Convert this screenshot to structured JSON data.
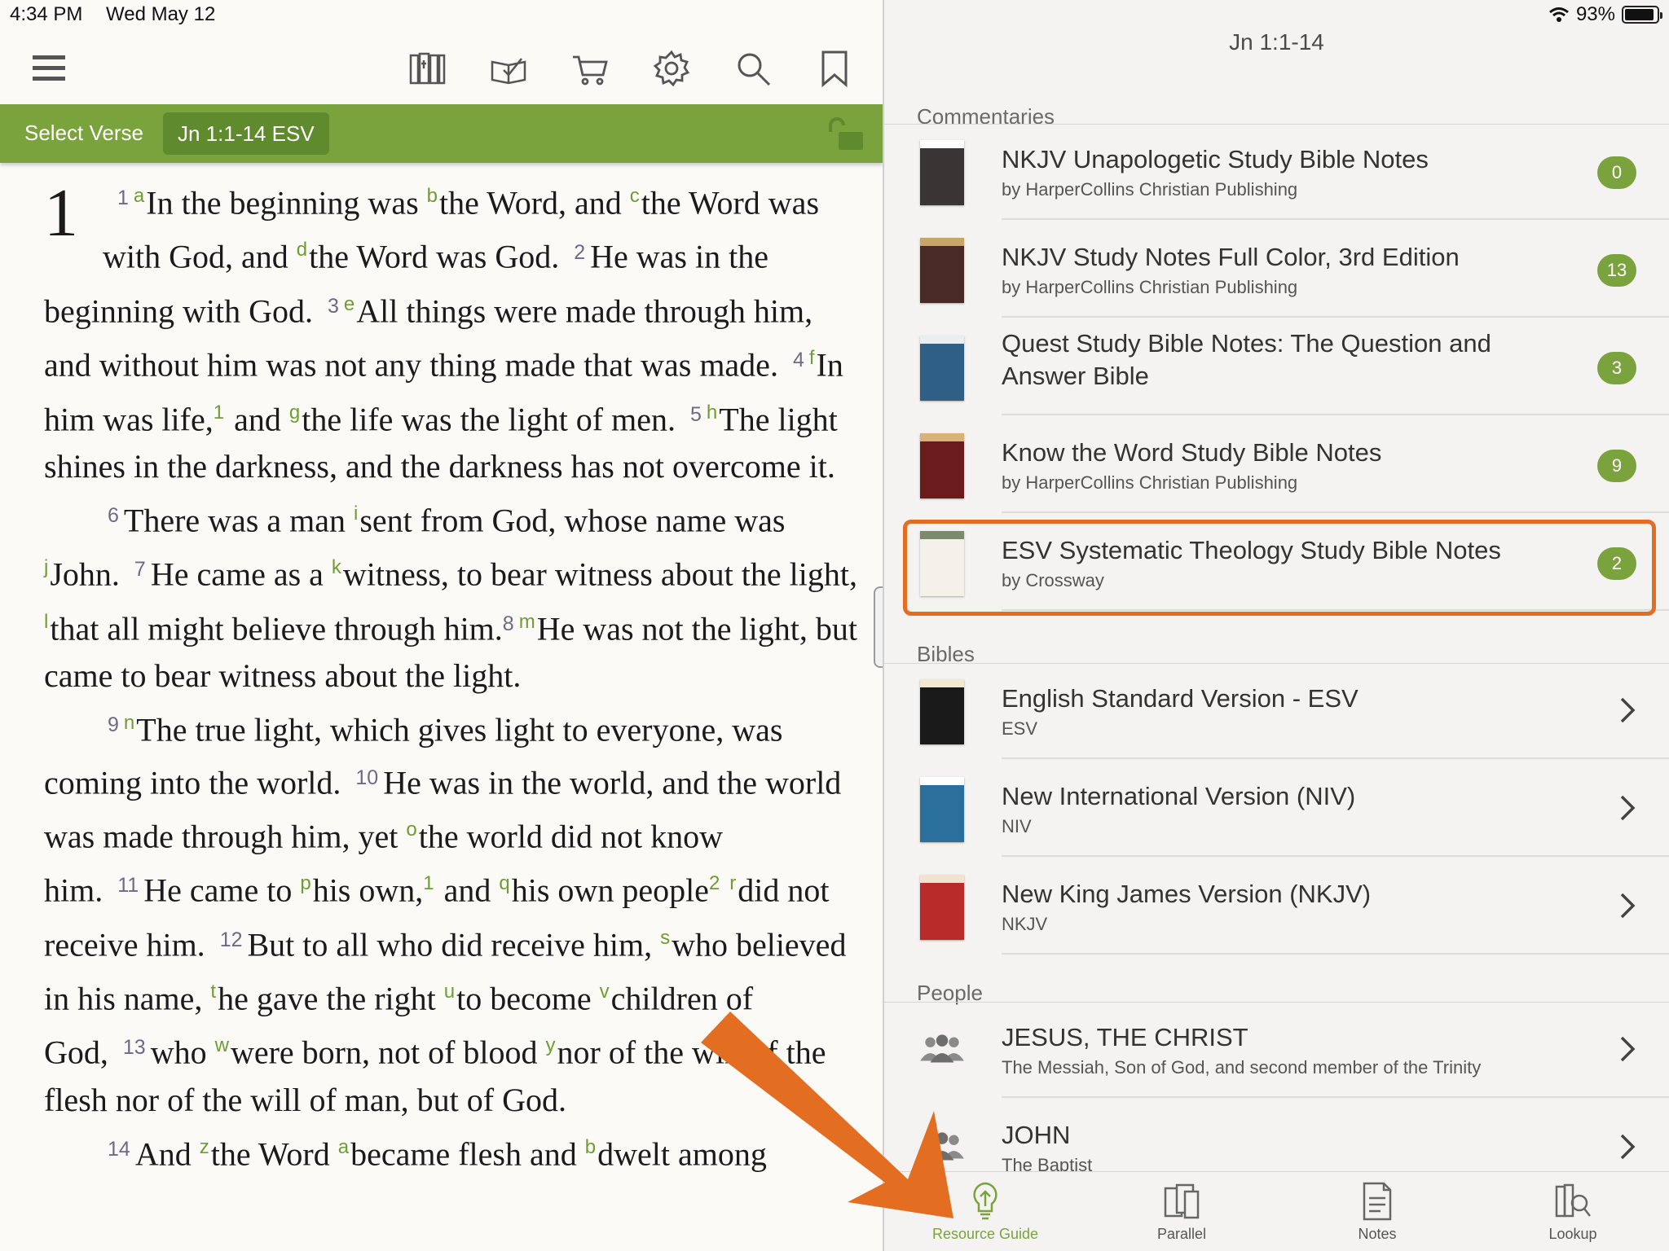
{
  "status": {
    "time": "4:34 PM",
    "date": "Wed May 12",
    "battery": "93%"
  },
  "toolbar": {
    "icons": [
      "menu-icon",
      "library-icon",
      "reading-plan-icon",
      "cart-icon",
      "settings-gear-icon",
      "search-icon",
      "bookmark-icon"
    ]
  },
  "passage_bar": {
    "select_label": "Select Verse",
    "reference": "Jn 1:1-14 ESV"
  },
  "scripture": {
    "chapter": "1",
    "verses": [
      {
        "n": "1",
        "parts": [
          [
            "a",
            "In the beginning was "
          ],
          [
            "b",
            "the Word, and "
          ],
          [
            "c",
            "the Word was with God, and "
          ],
          [
            "d",
            "the Word was God."
          ]
        ]
      },
      {
        "n": "2",
        "parts": [
          [
            "",
            "He was in the beginning with God."
          ]
        ]
      },
      {
        "n": "3",
        "parts": [
          [
            "e",
            "All things were made through him, and without him was not any thing made that was made."
          ]
        ]
      },
      {
        "n": "4",
        "parts": [
          [
            "f",
            "In him was life,"
          ],
          [
            "1",
            " and "
          ],
          [
            "g",
            "the life was the light of men."
          ]
        ]
      },
      {
        "n": "5",
        "parts": [
          [
            "h",
            "The light shines in the darkness, and the darkness has not overcome it."
          ]
        ]
      },
      {
        "n": "6",
        "parts": [
          [
            "",
            "There was a man "
          ],
          [
            "i",
            "sent from God, whose name was "
          ],
          [
            "j",
            "John."
          ]
        ]
      },
      {
        "n": "7",
        "parts": [
          [
            "",
            "He came as a "
          ],
          [
            "k",
            "witness, to bear witness about the light, "
          ],
          [
            "l",
            "that all might believe through him."
          ]
        ]
      },
      {
        "n": "8",
        "parts": [
          [
            "m",
            "He was not the light, but came to bear witness about the light."
          ]
        ]
      },
      {
        "n": "9",
        "parts": [
          [
            "n",
            "The true light, which gives light to everyone, was coming into the world."
          ]
        ]
      },
      {
        "n": "10",
        "parts": [
          [
            "",
            "He was in the world, and the world was made through him, yet "
          ],
          [
            "o",
            "the world did not know him."
          ]
        ]
      },
      {
        "n": "11",
        "parts": [
          [
            "",
            "He came to "
          ],
          [
            "p",
            "his own,"
          ],
          [
            "1",
            " and "
          ],
          [
            "q",
            "his own people"
          ],
          [
            "2",
            " "
          ],
          [
            "r",
            "did not receive him."
          ]
        ]
      },
      {
        "n": "12",
        "parts": [
          [
            "",
            "But to all who did receive him, "
          ],
          [
            "s",
            "who believed in his name, "
          ],
          [
            "t",
            "he gave the right "
          ],
          [
            "u",
            "to become "
          ],
          [
            "v",
            "children of God,"
          ]
        ]
      },
      {
        "n": "13",
        "parts": [
          [
            "",
            "who "
          ],
          [
            "w",
            "were born, not of blood "
          ],
          [
            "y",
            "nor of the will of the flesh nor of the will of man, but of God."
          ]
        ]
      },
      {
        "n": "14",
        "parts": [
          [
            "",
            "And "
          ],
          [
            "z",
            "the Word "
          ],
          [
            "a",
            "became flesh and "
          ],
          [
            "b",
            "dwelt among"
          ]
        ]
      }
    ]
  },
  "resource_guide": {
    "title": "Jn 1:1-14",
    "sections": [
      {
        "heading": "Commentaries",
        "items": [
          {
            "title": "NKJV Unapologetic Study Bible Notes",
            "subtitle": "by HarperCollins Christian Publishing",
            "count": "0",
            "cover": "unapologetic"
          },
          {
            "title": "NKJV Study Notes Full Color, 3rd Edition",
            "subtitle": "by HarperCollins Christian Publishing",
            "count": "13",
            "cover": "nkjv-study"
          },
          {
            "title": "Quest Study Bible Notes: The Question and Answer Bible",
            "subtitle": "",
            "count": "3",
            "cover": "quest"
          },
          {
            "title": "Know the Word Study Bible Notes",
            "subtitle": "by HarperCollins Christian Publishing",
            "count": "9",
            "cover": "know-word"
          },
          {
            "title": "ESV Systematic Theology Study Bible Notes",
            "subtitle": "by Crossway",
            "count": "2",
            "cover": "esv-systematic",
            "highlighted": true
          }
        ]
      },
      {
        "heading": "Bibles",
        "items": [
          {
            "title": "English Standard Version - ESV",
            "subtitle": "ESV",
            "cover": "esv"
          },
          {
            "title": "New International Version (NIV)",
            "subtitle": "NIV",
            "cover": "niv"
          },
          {
            "title": "New King James Version (NKJV)",
            "subtitle": "NKJV",
            "cover": "nkjv"
          }
        ]
      },
      {
        "heading": "People",
        "items": [
          {
            "title": "JESUS, THE CHRIST",
            "subtitle": "The Messiah, Son of God, and second member of the Trinity",
            "cover": "people-icon"
          },
          {
            "title": "JOHN",
            "subtitle": "The Baptist",
            "cover": "people-icon"
          }
        ]
      }
    ]
  },
  "tabs": [
    {
      "label": "Resource Guide",
      "icon": "lightbulb-icon",
      "active": true
    },
    {
      "label": "Parallel",
      "icon": "parallel-books-icon",
      "active": false
    },
    {
      "label": "Notes",
      "icon": "notes-icon",
      "active": false
    },
    {
      "label": "Lookup",
      "icon": "lookup-icon",
      "active": false
    }
  ],
  "colors": {
    "accent_green": "#7aa33e",
    "highlight_orange": "#e36d21",
    "verse_number": "#6e6a86"
  },
  "cover_colors": {
    "unapologetic": [
      "#3a3535",
      "#ffffff"
    ],
    "nkjv-study": [
      "#4a2a24",
      "#c9a46b"
    ],
    "quest": [
      "#2f5f85",
      "#e8eef4"
    ],
    "know-word": [
      "#6b1b1b",
      "#d8b27a"
    ],
    "esv-systematic": [
      "#f3f1ea",
      "#7a8a6a"
    ],
    "esv": [
      "#1a1a1a",
      "#f2ead0"
    ],
    "niv": [
      "#2b6f9c",
      "#ffffff"
    ],
    "nkjv": [
      "#b92b2b",
      "#f3e2d0"
    ]
  }
}
